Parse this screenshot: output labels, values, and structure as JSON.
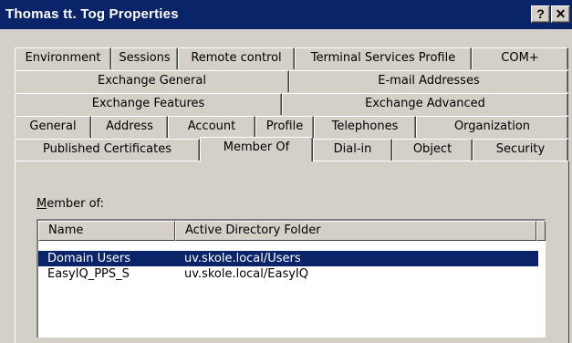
{
  "window": {
    "title": "Thomas tt. Tog Properties",
    "help_label": "?",
    "close_label": "✕"
  },
  "tabs": {
    "row1": [
      "Environment",
      "Sessions",
      "Remote control",
      "Terminal Services Profile",
      "COM+"
    ],
    "row2": [
      "Exchange General",
      "E-mail Addresses"
    ],
    "row3": [
      "Exchange Features",
      "Exchange Advanced"
    ],
    "row4": [
      "General",
      "Address",
      "Account",
      "Profile",
      "Telephones",
      "Organization"
    ],
    "row5": [
      "Published Certificates",
      "Member Of",
      "Dial-in",
      "Object",
      "Security"
    ],
    "active": "Member Of"
  },
  "member_of": {
    "label": "Member of:",
    "columns": [
      "Name",
      "Active Directory Folder"
    ],
    "rows": [
      {
        "name": "Domain Users",
        "folder": "uv.skole.local/Users",
        "selected": true
      },
      {
        "name": "EasyIQ_PPS_S",
        "folder": "uv.skole.local/EasyIQ",
        "selected": false
      }
    ]
  },
  "colors": {
    "titlebar": "#0a246a",
    "face": "#d4d0c8",
    "selection": "#0a246a"
  }
}
